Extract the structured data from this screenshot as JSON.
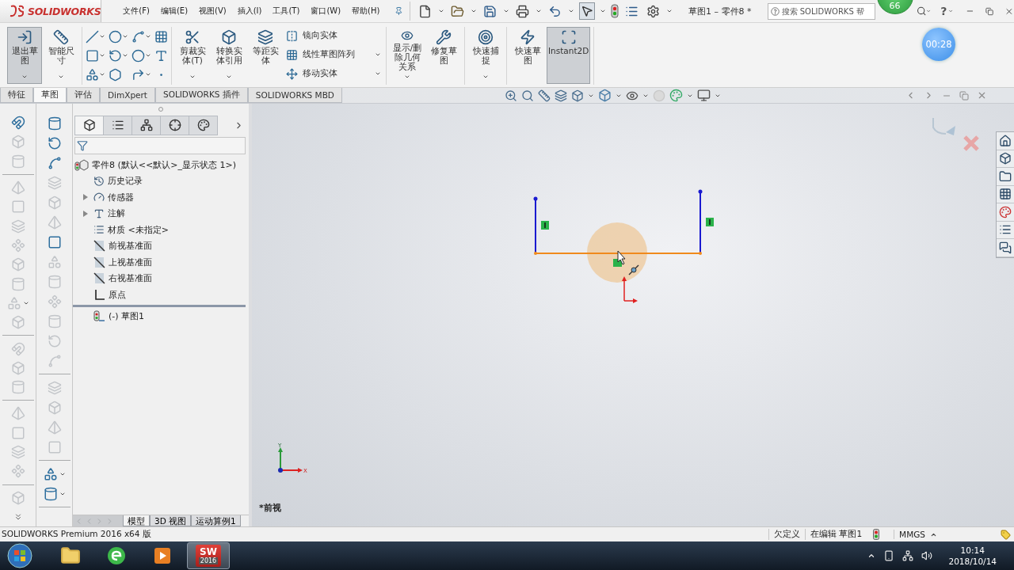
{
  "app": {
    "logo": "SOLIDWORKS"
  },
  "menu": [
    {
      "label": "文件(F)"
    },
    {
      "label": "编辑(E)"
    },
    {
      "label": "视图(V)"
    },
    {
      "label": "插入(I)"
    },
    {
      "label": "工具(T)"
    },
    {
      "label": "窗口(W)"
    },
    {
      "label": "帮助(H)"
    }
  ],
  "select_tool": {
    "selected": true
  },
  "document_title": "草图1 – 零件8 *",
  "search": {
    "placeholder": "搜索 SOLIDWORKS 帮"
  },
  "help": "?",
  "notification_badge": "66",
  "timer": "00:28",
  "ribbon": [
    {
      "items": [
        {
          "kind": "large",
          "label": "退出草图",
          "selected": true,
          "dropdown": true
        },
        {
          "kind": "large",
          "label": "智能尺寸",
          "selected": false,
          "dropdown": true
        }
      ]
    },
    {
      "items": [
        {
          "kind": "grid"
        }
      ]
    },
    {
      "items": [
        {
          "kind": "large",
          "label": "剪裁实体(T)",
          "selected": false,
          "dropdown": true
        },
        {
          "kind": "large",
          "label": "转换实体引用",
          "selected": false,
          "dropdown": true
        },
        {
          "kind": "large",
          "label": "等距实体",
          "selected": false,
          "dropdown": false
        },
        {
          "kind": "list",
          "entries": [
            {
              "label": "镜向实体",
              "dropdown": false
            },
            {
              "label": "线性草图阵列",
              "dropdown": true
            },
            {
              "label": "移动实体",
              "dropdown": true
            }
          ]
        }
      ]
    },
    {
      "items": [
        {
          "kind": "large",
          "label": "显示/删除几何关系",
          "selected": false,
          "dropdown": true
        },
        {
          "kind": "large",
          "label": "修复草图",
          "selected": false,
          "dropdown": false
        }
      ]
    },
    {
      "items": [
        {
          "kind": "large",
          "label": "快速捕捉",
          "selected": false,
          "dropdown": true
        }
      ]
    },
    {
      "items": [
        {
          "kind": "large",
          "label": "快速草图",
          "selected": false,
          "dropdown": false
        },
        {
          "kind": "large",
          "label": "Instant2D",
          "selected": true,
          "dropdown": false
        }
      ]
    }
  ],
  "tabs": [
    {
      "label": "特征",
      "selected": false
    },
    {
      "label": "草图",
      "selected": true
    },
    {
      "label": "评估",
      "selected": false
    },
    {
      "label": "DimXpert",
      "selected": false
    },
    {
      "label": "SOLIDWORKS 插件",
      "selected": false
    },
    {
      "label": "SOLIDWORKS MBD",
      "selected": false
    }
  ],
  "left_toolbars": [
    [
      {
        "kind": "tool",
        "disabled": false,
        "dropdown": false
      },
      {
        "kind": "tool",
        "disabled": true,
        "dropdown": false
      },
      {
        "kind": "tool",
        "disabled": true,
        "dropdown": false
      },
      {
        "kind": "separator"
      },
      {
        "kind": "tool",
        "disabled": true,
        "dropdown": false
      },
      {
        "kind": "tool",
        "disabled": true,
        "dropdown": false
      },
      {
        "kind": "tool",
        "disabled": true,
        "dropdown": false
      },
      {
        "kind": "tool",
        "disabled": true,
        "dropdown": false
      },
      {
        "kind": "tool",
        "disabled": true,
        "dropdown": false
      },
      {
        "kind": "tool",
        "disabled": true,
        "dropdown": false
      },
      {
        "kind": "tool",
        "disabled": true,
        "dropdown": true
      },
      {
        "kind": "tool",
        "disabled": true,
        "dropdown": false
      },
      {
        "kind": "separator"
      },
      {
        "kind": "tool",
        "disabled": true,
        "dropdown": false
      },
      {
        "kind": "tool",
        "disabled": true,
        "dropdown": false
      },
      {
        "kind": "tool",
        "disabled": true,
        "dropdown": false
      },
      {
        "kind": "separator"
      },
      {
        "kind": "tool",
        "disabled": true,
        "dropdown": false
      },
      {
        "kind": "tool",
        "disabled": true,
        "dropdown": false
      },
      {
        "kind": "tool",
        "disabled": true,
        "dropdown": false
      },
      {
        "kind": "tool",
        "disabled": true,
        "dropdown": false
      },
      {
        "kind": "separator"
      },
      {
        "kind": "tool",
        "disabled": true,
        "dropdown": false
      },
      {
        "kind": "more"
      }
    ],
    [
      {
        "kind": "tool",
        "disabled": false,
        "dropdown": false
      },
      {
        "kind": "tool",
        "disabled": false,
        "dropdown": false
      },
      {
        "kind": "tool",
        "disabled": false,
        "dropdown": false
      },
      {
        "kind": "tool",
        "disabled": true,
        "dropdown": false
      },
      {
        "kind": "tool",
        "disabled": true,
        "dropdown": false
      },
      {
        "kind": "tool",
        "disabled": true,
        "dropdown": false
      },
      {
        "kind": "tool",
        "disabled": false,
        "dropdown": false
      },
      {
        "kind": "tool",
        "disabled": true,
        "dropdown": false
      },
      {
        "kind": "tool",
        "disabled": true,
        "dropdown": false
      },
      {
        "kind": "tool",
        "disabled": true,
        "dropdown": false
      },
      {
        "kind": "tool",
        "disabled": true,
        "dropdown": false
      },
      {
        "kind": "tool",
        "disabled": true,
        "dropdown": false
      },
      {
        "kind": "tool",
        "disabled": true,
        "dropdown": false
      },
      {
        "kind": "separator"
      },
      {
        "kind": "tool",
        "disabled": true,
        "dropdown": false
      },
      {
        "kind": "tool",
        "disabled": true,
        "dropdown": false
      },
      {
        "kind": "tool",
        "disabled": true,
        "dropdown": false
      },
      {
        "kind": "tool",
        "disabled": true,
        "dropdown": false
      },
      {
        "kind": "separator"
      },
      {
        "kind": "tool",
        "disabled": false,
        "dropdown": true
      },
      {
        "kind": "tool",
        "disabled": false,
        "dropdown": true
      },
      {
        "kind": "separator"
      }
    ]
  ],
  "panel_tabs": [
    {
      "selected": true
    },
    {
      "selected": false
    },
    {
      "selected": false
    },
    {
      "selected": false
    },
    {
      "selected": false
    }
  ],
  "tree": {
    "label": "零件8  (默认<<默认>_显示状态 1>)",
    "children": [
      {
        "kind": "history",
        "label": "历史记录",
        "expandable": false
      },
      {
        "kind": "sensor",
        "label": "传感器",
        "expandable": true
      },
      {
        "kind": "annotation",
        "label": "注解",
        "expandable": true
      },
      {
        "kind": "material",
        "label": "材质 <未指定>",
        "expandable": false
      },
      {
        "kind": "plane",
        "label": "前视基准面",
        "expandable": false
      },
      {
        "kind": "plane",
        "label": "上视基准面",
        "expandable": false
      },
      {
        "kind": "plane",
        "label": "右视基准面",
        "expandable": false
      },
      {
        "kind": "origin",
        "label": "原点",
        "expandable": false
      }
    ],
    "after_rollback": [
      {
        "kind": "sketch",
        "label": "(-) 草图1"
      }
    ]
  },
  "bottom_tabs": [
    {
      "label": "模型",
      "selected": true
    },
    {
      "label": "3D 视图",
      "selected": false
    },
    {
      "label": "运动算例1",
      "selected": false
    }
  ],
  "viewport": {
    "view_label": "*前视",
    "triad": {
      "x": "X",
      "y": "Y"
    }
  },
  "status_bar": {
    "product": "SOLIDWORKS Premium 2016 x64 版",
    "state": "欠定义",
    "editing": "在编辑 草图1",
    "units": "MMGS"
  },
  "taskbar": {
    "apps": [
      {
        "kind": "folder",
        "selected": false
      },
      {
        "kind": "browser",
        "selected": false
      },
      {
        "kind": "media",
        "selected": false
      },
      {
        "kind": "solidworks",
        "selected": true,
        "label": "SW",
        "version": "2016"
      }
    ],
    "time": "10:14",
    "date": "2018/10/14"
  }
}
